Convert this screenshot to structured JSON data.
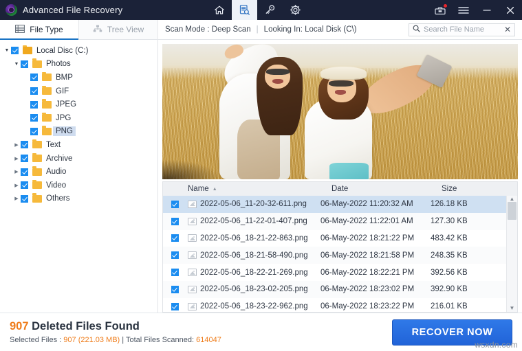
{
  "window": {
    "title": "Advanced File Recovery",
    "logo_icon": "app-logo-icon",
    "nav_icons": [
      {
        "name": "home-icon",
        "active": false
      },
      {
        "name": "scan-document-icon",
        "active": true
      },
      {
        "name": "key-icon",
        "active": false
      },
      {
        "name": "gear-icon",
        "active": false
      }
    ],
    "right_icons": [
      {
        "name": "toolbox-icon",
        "badge": true
      },
      {
        "name": "hamburger-menu-icon",
        "badge": false
      },
      {
        "name": "minimize-icon",
        "badge": false
      },
      {
        "name": "close-icon",
        "badge": false
      }
    ]
  },
  "tabs": [
    {
      "label": "File Type",
      "icon": "grid-list-icon",
      "active": true
    },
    {
      "label": "Tree View",
      "icon": "tree-hierarchy-icon",
      "active": false
    }
  ],
  "scanbar": {
    "scan_mode": "Scan Mode : Deep Scan",
    "separator": "|",
    "looking_in": "Looking In: Local Disk (C\\)"
  },
  "search": {
    "placeholder": "Search File Name",
    "value": "",
    "icon": "search-icon",
    "clear_icon": "close-icon"
  },
  "tree": [
    {
      "label": "Local Disc (C:)",
      "depth": 0,
      "checked": true,
      "expanded": true,
      "arrow": "down",
      "selected": false
    },
    {
      "label": "Photos",
      "depth": 1,
      "checked": true,
      "expanded": true,
      "arrow": "down",
      "selected": false
    },
    {
      "label": "BMP",
      "depth": 2,
      "checked": true,
      "expanded": false,
      "arrow": "none",
      "selected": false
    },
    {
      "label": "GIF",
      "depth": 2,
      "checked": true,
      "expanded": false,
      "arrow": "none",
      "selected": false
    },
    {
      "label": "JPEG",
      "depth": 2,
      "checked": true,
      "expanded": false,
      "arrow": "none",
      "selected": false
    },
    {
      "label": "JPG",
      "depth": 2,
      "checked": true,
      "expanded": false,
      "arrow": "none",
      "selected": false
    },
    {
      "label": "PNG",
      "depth": 2,
      "checked": true,
      "expanded": false,
      "arrow": "none",
      "selected": true
    },
    {
      "label": "Text",
      "depth": 1,
      "checked": true,
      "expanded": false,
      "arrow": "right",
      "selected": false
    },
    {
      "label": "Archive",
      "depth": 1,
      "checked": true,
      "expanded": false,
      "arrow": "right",
      "selected": false
    },
    {
      "label": "Audio",
      "depth": 1,
      "checked": true,
      "expanded": false,
      "arrow": "right",
      "selected": false
    },
    {
      "label": "Video",
      "depth": 1,
      "checked": true,
      "expanded": false,
      "arrow": "right",
      "selected": false
    },
    {
      "label": "Others",
      "depth": 1,
      "checked": true,
      "expanded": false,
      "arrow": "right",
      "selected": false
    }
  ],
  "preview": {
    "description": "Photo preview: two smiling young women taking a selfie with a phone in a golden wheat field"
  },
  "table": {
    "columns": {
      "name": "Name",
      "date": "Date",
      "size": "Size"
    },
    "sort_column": "Name",
    "sort_direction": "asc",
    "rows": [
      {
        "name": "2022-05-06_11-20-32-611.png",
        "date": "06-May-2022 11:20:32 AM",
        "size": "126.18 KB",
        "checked": true,
        "selected": true
      },
      {
        "name": "2022-05-06_11-22-01-407.png",
        "date": "06-May-2022 11:22:01 AM",
        "size": "127.30 KB",
        "checked": true,
        "selected": false
      },
      {
        "name": "2022-05-06_18-21-22-863.png",
        "date": "06-May-2022 18:21:22 PM",
        "size": "483.42 KB",
        "checked": true,
        "selected": false
      },
      {
        "name": "2022-05-06_18-21-58-490.png",
        "date": "06-May-2022 18:21:58 PM",
        "size": "248.35 KB",
        "checked": true,
        "selected": false
      },
      {
        "name": "2022-05-06_18-22-21-269.png",
        "date": "06-May-2022 18:22:21 PM",
        "size": "392.56 KB",
        "checked": true,
        "selected": false
      },
      {
        "name": "2022-05-06_18-23-02-205.png",
        "date": "06-May-2022 18:23:02 PM",
        "size": "392.90 KB",
        "checked": true,
        "selected": false
      },
      {
        "name": "2022-05-06_18-23-22-962.png",
        "date": "06-May-2022 18:23:22 PM",
        "size": "216.01 KB",
        "checked": true,
        "selected": false
      }
    ]
  },
  "footer": {
    "found_count": "907",
    "found_label": "Deleted Files Found",
    "selected_prefix": "Selected Files : ",
    "selected_count": "907",
    "selected_size": "(221.03 MB)",
    "divider": " | ",
    "scanned_label": "Total Files Scanned: ",
    "scanned_count": "614047",
    "recover_button": "RECOVER NOW"
  },
  "watermark": "wsxdn.com",
  "colors": {
    "titlebar": "#1b2238",
    "accent_blue": "#1a73c4",
    "button_blue": "#2163d8",
    "orange": "#ef7c1a",
    "folder": "#f6b93b",
    "checkbox": "#1a8cf0",
    "row_selected": "#cfe0f2"
  }
}
